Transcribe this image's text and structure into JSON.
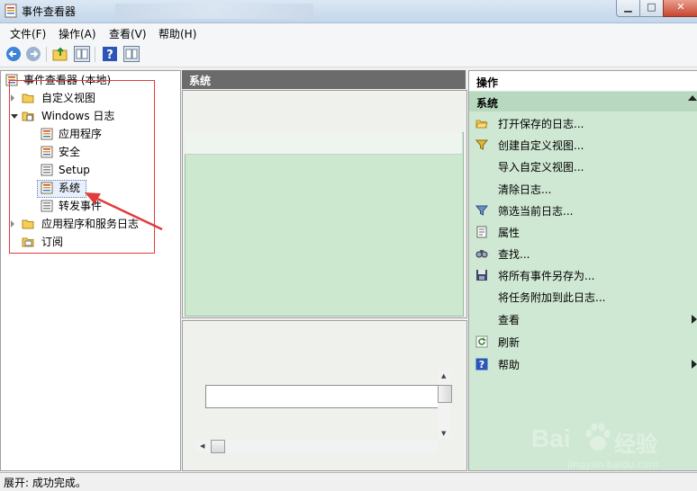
{
  "window": {
    "title": "事件查看器",
    "blurred_text": ""
  },
  "menu": [
    "文件(F)",
    "操作(A)",
    "查看(V)",
    "帮助(H)"
  ],
  "tree": {
    "root": "事件查看器 (本地)",
    "custom_views": "自定义视图",
    "windows_logs": "Windows 日志",
    "logs": [
      "应用程序",
      "安全",
      "Setup",
      "系统",
      "转发事件"
    ],
    "app_services": "应用程序和服务日志",
    "subscriptions": "订阅"
  },
  "middle": {
    "header": "系统"
  },
  "actions": {
    "title": "操作",
    "section": "系统",
    "items": [
      {
        "label": "打开保存的日志...",
        "icon": "folder-open-icon",
        "submenu": false
      },
      {
        "label": "创建自定义视图...",
        "icon": "filter-icon",
        "submenu": false
      },
      {
        "label": "导入自定义视图...",
        "icon": "",
        "submenu": false
      },
      {
        "label": "清除日志...",
        "icon": "",
        "submenu": false
      },
      {
        "label": "筛选当前日志...",
        "icon": "filter-icon",
        "submenu": false
      },
      {
        "label": "属性",
        "icon": "properties-icon",
        "submenu": false
      },
      {
        "label": "查找...",
        "icon": "find-icon",
        "submenu": false
      },
      {
        "label": "将所有事件另存为...",
        "icon": "save-icon",
        "submenu": false
      },
      {
        "label": "将任务附加到此日志...",
        "icon": "",
        "submenu": false
      },
      {
        "label": "查看",
        "icon": "",
        "submenu": true
      },
      {
        "label": "刷新",
        "icon": "refresh-icon",
        "submenu": false
      },
      {
        "label": "帮助",
        "icon": "help-icon",
        "submenu": true
      }
    ]
  },
  "status": "展开: 成功完成。",
  "watermark": {
    "brand": "Bai",
    "brand2": "经验",
    "url": "jingyan.baidu.com"
  },
  "colors": {
    "annotation_red": "#e23b3b",
    "actions_bg": "#cfe8d3",
    "pane_header": "#6b6b6b"
  }
}
